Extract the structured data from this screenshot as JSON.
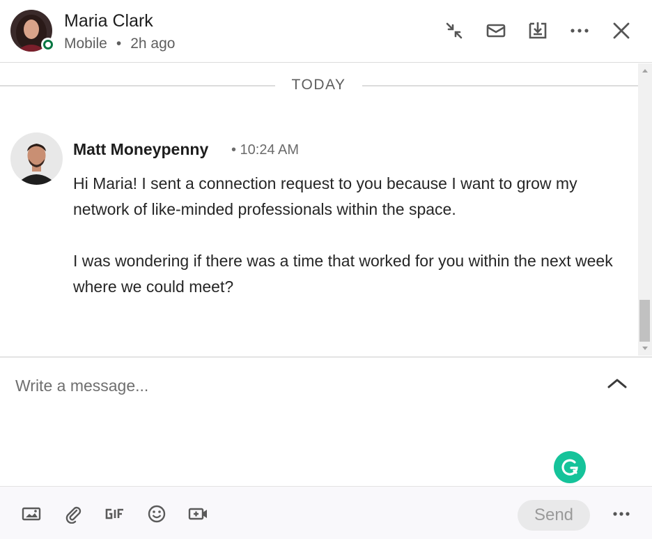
{
  "header": {
    "contact_name": "Maria Clark",
    "device": "Mobile",
    "separator": "•",
    "last_active": "2h ago",
    "status_color": "#057642"
  },
  "thread": {
    "day_label": "TODAY",
    "messages": [
      {
        "sender": "Matt Moneypenny",
        "time": "• 10:24 AM",
        "paragraphs": [
          "Hi Maria! I sent a connection request to you because I want to grow my network of like-minded professionals within the space.",
          "I was wondering if there was a time that worked for you within the next week where we could meet?"
        ]
      }
    ]
  },
  "compose": {
    "placeholder": "Write a message...",
    "grammarly_color": "#15c39a"
  },
  "footer": {
    "send_label": "Send",
    "tools": [
      "image-icon",
      "paperclip-icon",
      "gif-icon",
      "emoji-icon",
      "video-call-icon"
    ]
  }
}
